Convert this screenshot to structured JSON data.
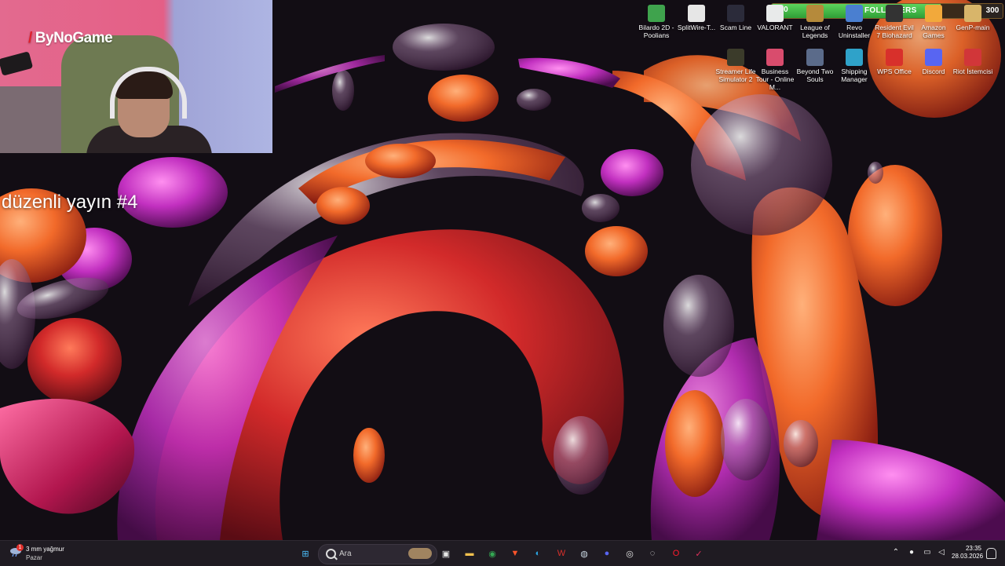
{
  "webcam": {
    "logo_text": "ByNoGame"
  },
  "stream": {
    "title": "düzenli yayın #4"
  },
  "followers_goal": {
    "label": "FOLLOWERS",
    "current": "220",
    "target": "300",
    "progress": 0.73
  },
  "desktop_icons": [
    {
      "label": "Bilardo 2D - Poolians",
      "icon": "bilardo-icon",
      "color": "#3fa34d"
    },
    {
      "label": "SplitWire-T...",
      "icon": "splitwire-icon",
      "color": "#e6e6e6"
    },
    {
      "label": "Scam Line",
      "icon": "scamline-icon",
      "color": "#2b2b3a"
    },
    {
      "label": "VALORANT",
      "icon": "valorant-icon",
      "color": "#e8eaea"
    },
    {
      "label": "League of Legends",
      "icon": "league-icon",
      "color": "#b58a3b"
    },
    {
      "label": "Revo Uninstaller",
      "icon": "revo-icon",
      "color": "#4a7fd0"
    },
    {
      "label": "Resident Evil 7 Biohazard",
      "icon": "re7-icon",
      "color": "#333333"
    },
    {
      "label": "Amazon Games",
      "icon": "amazon-games-icon",
      "color": "#f2a93b"
    },
    {
      "label": "GenP-main",
      "icon": "folder-icon",
      "color": "#d8b56a"
    },
    {
      "label": "Streamer Life Simulator 2",
      "icon": "streamer-life-icon",
      "color": "#3b3b2a"
    },
    {
      "label": "Business Tour - Online M...",
      "icon": "business-tour-icon",
      "color": "#d94c6d"
    },
    {
      "label": "Beyond Two Souls",
      "icon": "beyond-two-souls-icon",
      "color": "#5b6b8a"
    },
    {
      "label": "Shipping Manager",
      "icon": "shipping-manager-icon",
      "color": "#2fa2c9"
    },
    {
      "label": "WPS Office",
      "icon": "wps-office-icon",
      "color": "#d8302b"
    },
    {
      "label": "Discord",
      "icon": "discord-icon",
      "color": "#5865f2"
    },
    {
      "label": "Riot İstemcisi",
      "icon": "riot-client-icon",
      "color": "#d13639"
    }
  ],
  "taskbar": {
    "weather": {
      "temp_text": "3 mm yağmur",
      "day": "Pazar",
      "badge": "1"
    },
    "search_placeholder": "Ara",
    "apps": [
      {
        "name": "start-button-icon",
        "glyph": "⊞",
        "color": "#4cc2ff"
      },
      {
        "name": "task-view-icon",
        "glyph": "▣",
        "color": "#e6e6e6"
      },
      {
        "name": "file-explorer-icon",
        "glyph": "▬",
        "color": "#f2c14e"
      },
      {
        "name": "chrome-icon",
        "glyph": "◉",
        "color": "#34a853"
      },
      {
        "name": "brave-icon",
        "glyph": "▼",
        "color": "#fb542b"
      },
      {
        "name": "edge-icon",
        "glyph": "◐",
        "color": "#2aa4e0"
      },
      {
        "name": "wps-office-icon",
        "glyph": "W",
        "color": "#d8302b"
      },
      {
        "name": "steam-icon",
        "glyph": "◍",
        "color": "#c7d5e0"
      },
      {
        "name": "discord-icon",
        "glyph": "●",
        "color": "#5865f2"
      },
      {
        "name": "obs-icon",
        "glyph": "◎",
        "color": "#e6e6e6"
      },
      {
        "name": "github-desktop-icon",
        "glyph": "◌",
        "color": "#e6e6e6"
      },
      {
        "name": "opera-icon",
        "glyph": "O",
        "color": "#ff1b2d"
      },
      {
        "name": "red-app-icon",
        "glyph": "✓",
        "color": "#e0315c"
      }
    ],
    "clock": {
      "time": "23:35",
      "date": "28.03.2026"
    }
  }
}
